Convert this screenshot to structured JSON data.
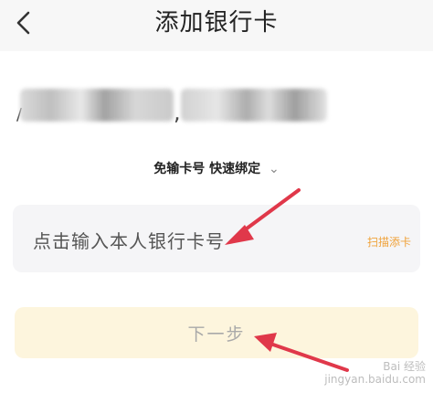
{
  "header": {
    "title": "添加银行卡"
  },
  "quick_bind": {
    "label": "免输卡号 快速绑定",
    "chevron": "⌄"
  },
  "card_input": {
    "placeholder": "点击输入本人银行卡号",
    "scan_label": "扫描添卡"
  },
  "next_button": {
    "label": "下一步"
  },
  "watermark": {
    "text": "Bai 经验",
    "sub": "jingyan.baidu.com"
  },
  "colors": {
    "accent_orange": "#f0a23a",
    "annotation_arrow": "#e0384a",
    "next_button_bg": "#fdf5dd"
  }
}
